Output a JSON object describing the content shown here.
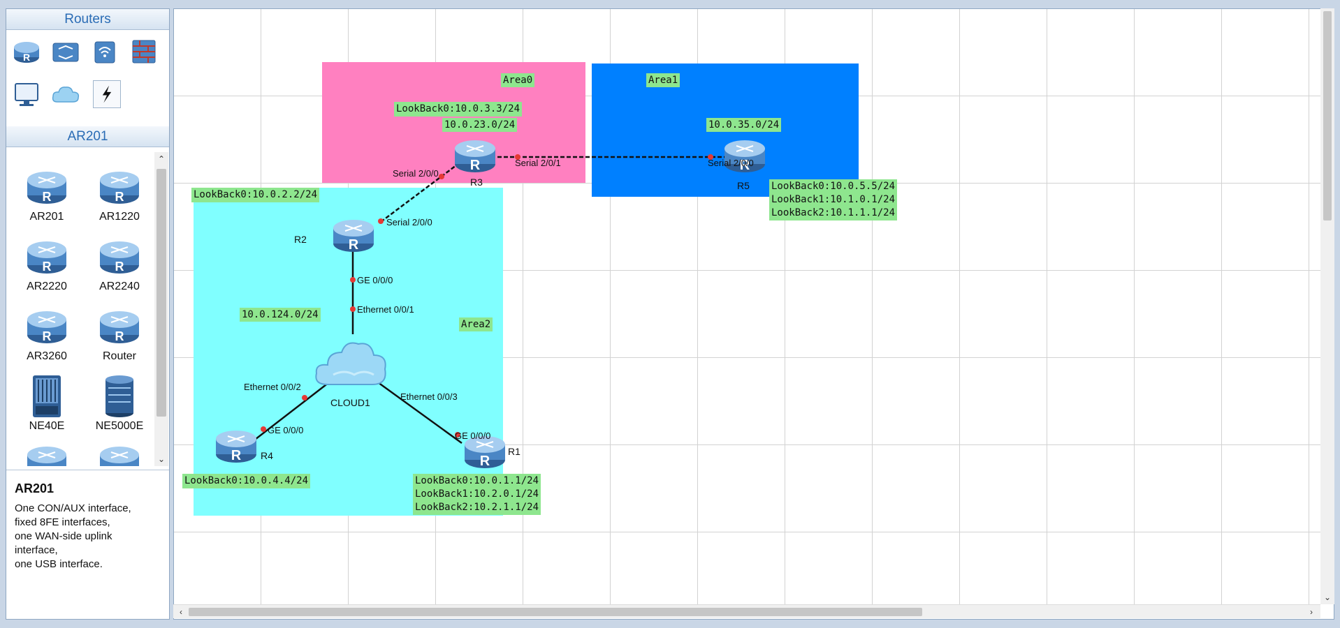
{
  "panel": {
    "routers_header": "Routers",
    "model_header": "AR201",
    "categories": [
      {
        "icon": "router-icon"
      },
      {
        "icon": "switch-icon"
      },
      {
        "icon": "wireless-icon"
      },
      {
        "icon": "firewall-icon"
      },
      {
        "icon": "pc-icon"
      },
      {
        "icon": "cloud-icon"
      },
      {
        "icon": "connection-icon"
      }
    ],
    "models": [
      {
        "label": "AR201",
        "icon": "router-icon"
      },
      {
        "label": "AR1220",
        "icon": "router-icon"
      },
      {
        "label": "AR2220",
        "icon": "router-icon"
      },
      {
        "label": "AR2240",
        "icon": "router-icon"
      },
      {
        "label": "AR3260",
        "icon": "router-icon"
      },
      {
        "label": "Router",
        "icon": "router-icon"
      },
      {
        "label": "NE40E",
        "icon": "chassis-icon"
      },
      {
        "label": "NE5000E",
        "icon": "chassis-icon"
      }
    ],
    "description": {
      "title": "AR201",
      "lines": [
        "One CON/AUX interface,",
        "fixed 8FE interfaces,",
        "one WAN-side uplink",
        "interface,",
        "one USB interface."
      ]
    }
  },
  "topology": {
    "areas": [
      {
        "label": "Area0",
        "color": "#ff80c0"
      },
      {
        "label": "Area1",
        "color": "#0080ff"
      },
      {
        "label": "Area2",
        "color": "#80ffff"
      }
    ],
    "networks": {
      "n23": "10.0.23.0/24",
      "n35": "10.0.35.0/24",
      "n124": "10.0.124.0/24"
    },
    "routers": {
      "r1": {
        "name": "R1",
        "loopbacks": [
          "LookBack0:10.0.1.1/24",
          "LookBack1:10.2.0.1/24",
          "LookBack2:10.2.1.1/24"
        ]
      },
      "r2": {
        "name": "R2",
        "loopbacks": [
          "LookBack0:10.0.2.2/24"
        ]
      },
      "r3": {
        "name": "R3",
        "loopbacks": [
          "LookBack0:10.0.3.3/24"
        ]
      },
      "r4": {
        "name": "R4",
        "loopbacks": [
          "LookBack0:10.0.4.4/24"
        ]
      },
      "r5": {
        "name": "R5",
        "loopbacks": [
          "LookBack0:10.0.5.5/24",
          "LookBack1:10.1.0.1/24",
          "LookBack2:10.1.1.1/24"
        ]
      }
    },
    "cloud": {
      "name": "CLOUD1"
    },
    "interfaces": {
      "r3_s200": "Serial 2/0/0",
      "r3_s201": "Serial 2/0/1",
      "r5_s200": "Serial 2/0/0",
      "r2_s200": "Serial 2/0/0",
      "r2_ge000": "GE 0/0/0",
      "cloud_e001": "Ethernet 0/0/1",
      "cloud_e002": "Ethernet 0/0/2",
      "cloud_e003": "Ethernet 0/0/3",
      "r4_ge000": "GE 0/0/0",
      "r1_ge000": "GE 0/0/0"
    },
    "colors": {
      "link": "#111111",
      "port": "#e53935",
      "label_bg": "#8ee68e"
    }
  }
}
